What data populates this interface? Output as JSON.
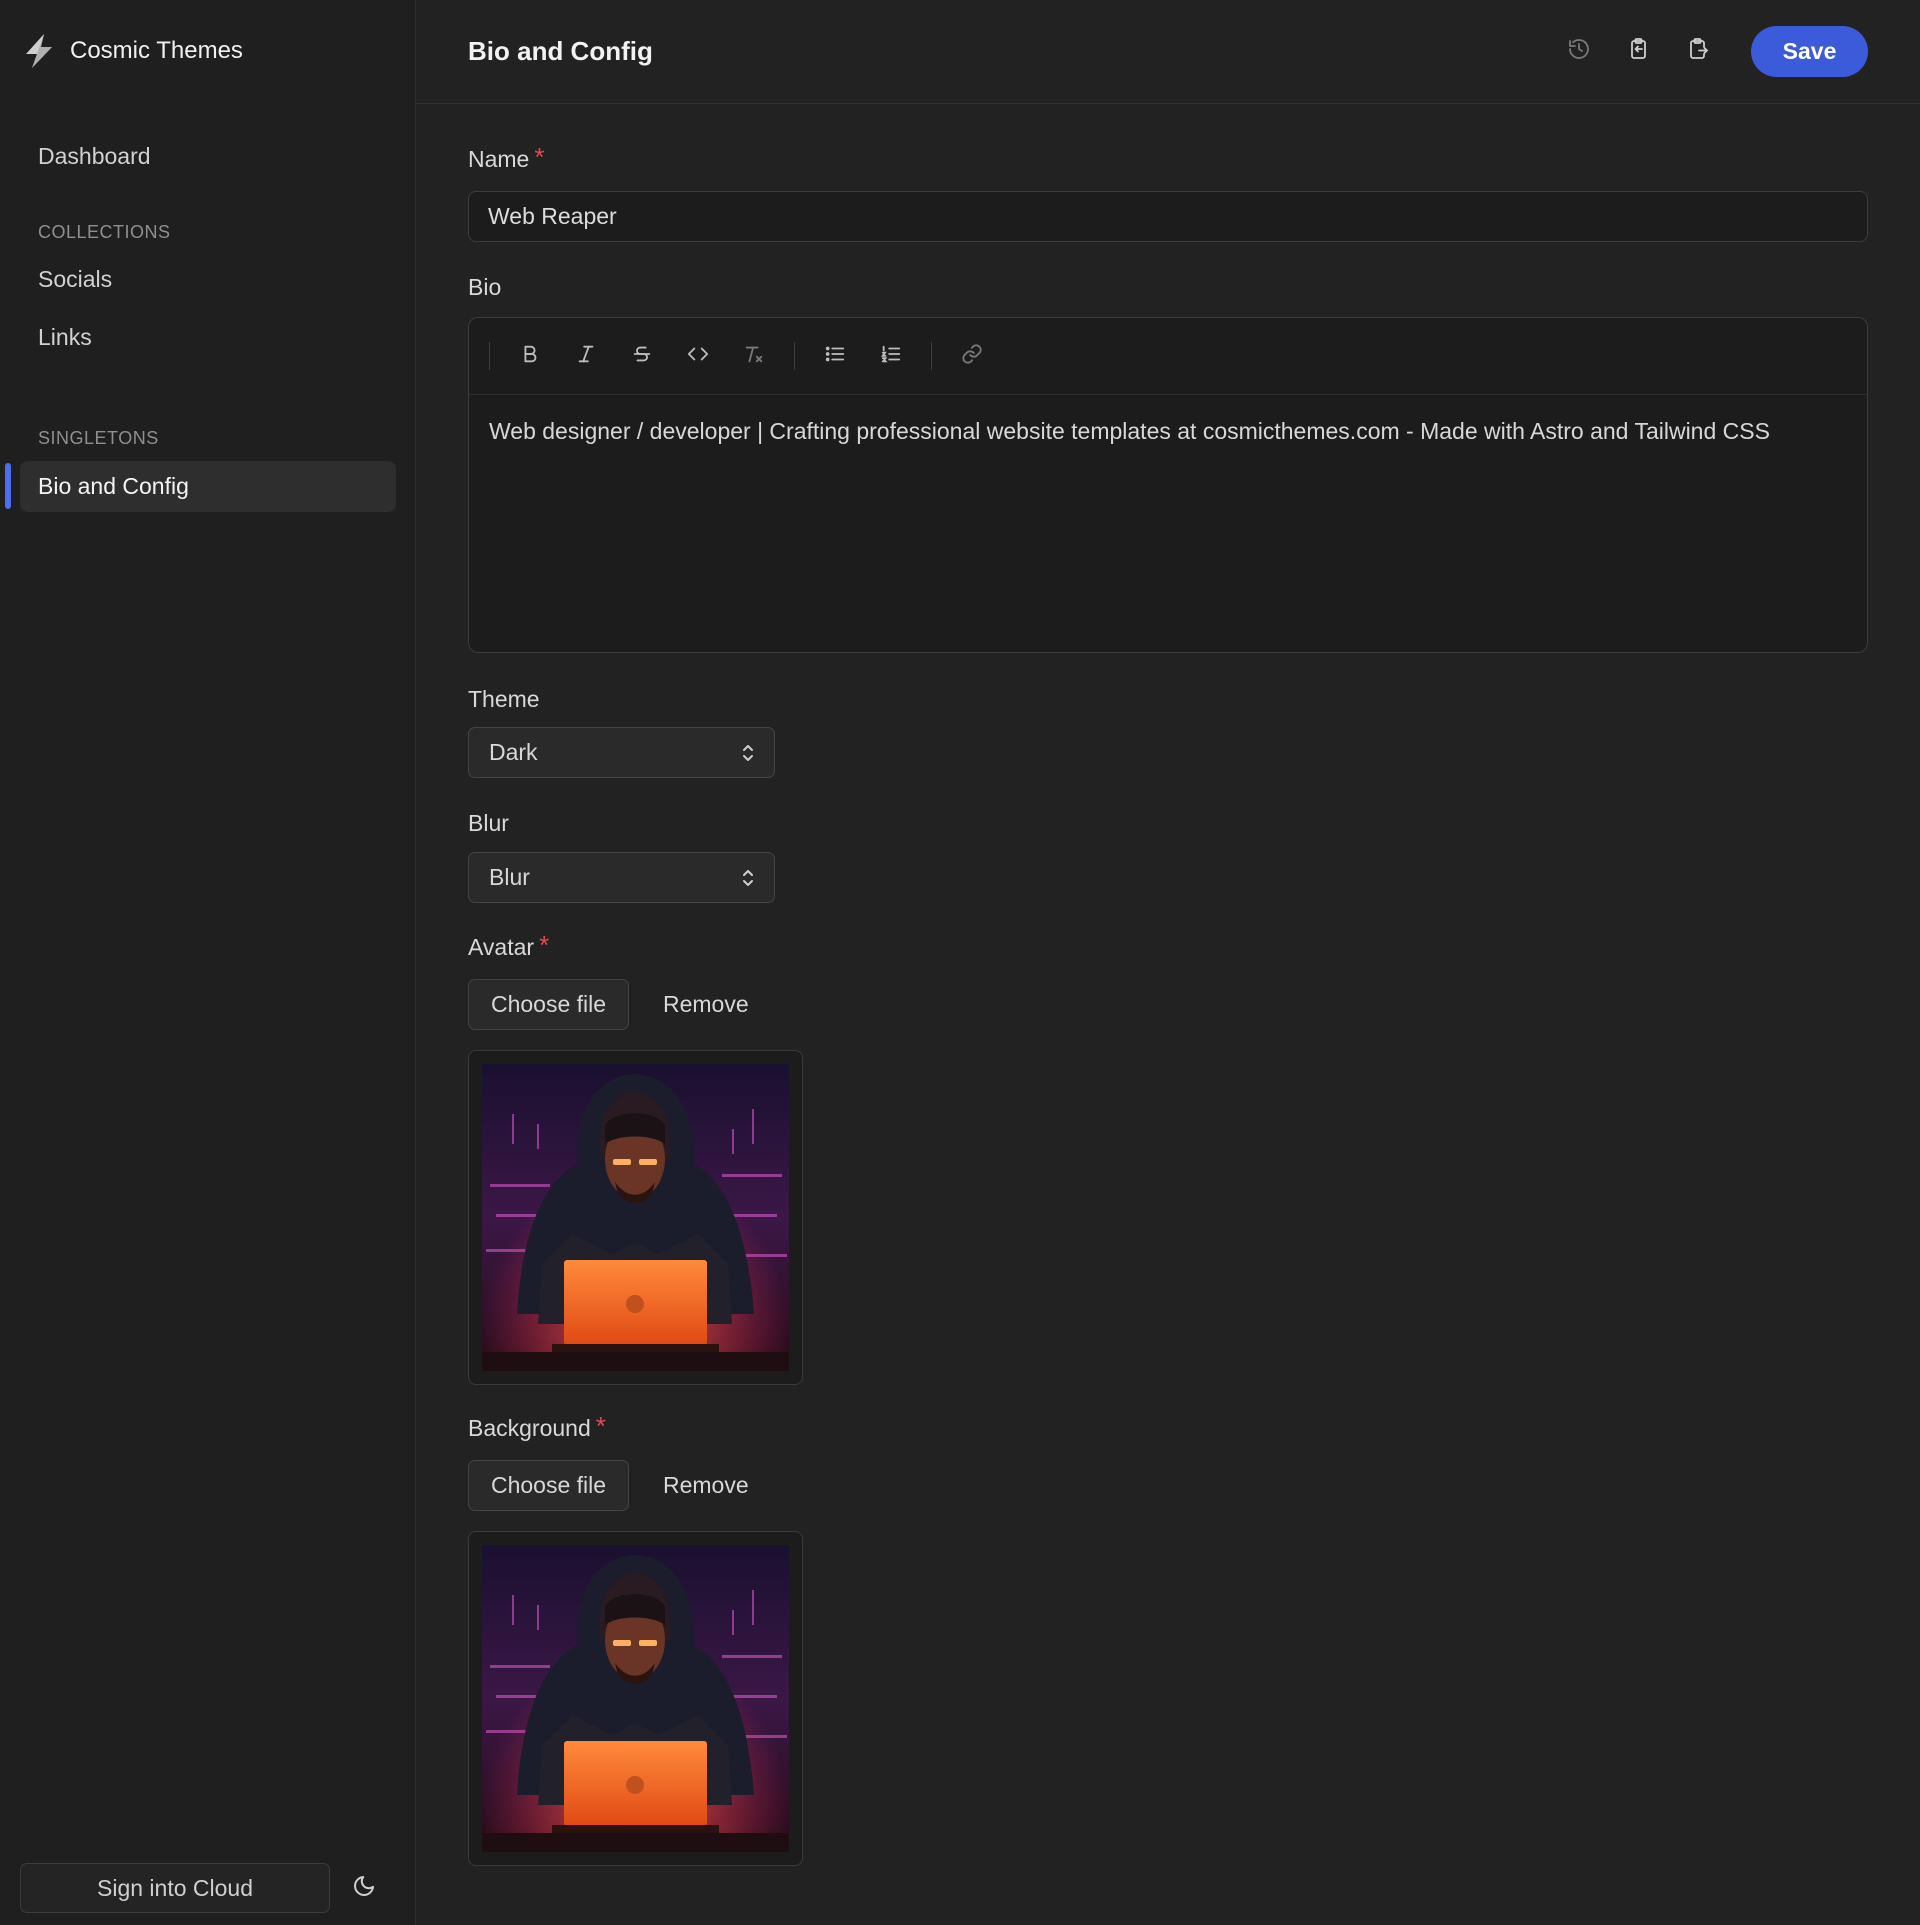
{
  "app": {
    "brand_name": "Cosmic Themes"
  },
  "sidebar": {
    "dashboard": "Dashboard",
    "collections_label": "COLLECTIONS",
    "collections": [
      {
        "label": "Socials"
      },
      {
        "label": "Links"
      }
    ],
    "singletons_label": "SINGLETONS",
    "singletons": [
      {
        "label": "Bio and Config",
        "active": true
      }
    ],
    "footer": {
      "sign_in_label": "Sign into Cloud"
    }
  },
  "header": {
    "title": "Bio and Config",
    "save_label": "Save"
  },
  "form": {
    "name": {
      "label": "Name",
      "required": true,
      "value": "Web Reaper"
    },
    "bio": {
      "label": "Bio",
      "content": "Web designer / developer | Crafting professional website templates at cosmicthemes.com - Made with Astro and Tailwind CSS"
    },
    "theme": {
      "label": "Theme",
      "value": "Dark"
    },
    "blur": {
      "label": "Blur",
      "value": "Blur"
    },
    "avatar": {
      "label": "Avatar",
      "required": true,
      "choose_label": "Choose file",
      "remove_label": "Remove"
    },
    "background": {
      "label": "Background",
      "required": true,
      "choose_label": "Choose file",
      "remove_label": "Remove"
    }
  },
  "colors": {
    "accent": "#3b5bdb",
    "active_indicator": "#4d6df0",
    "required": "#e5484d",
    "background": "#222222",
    "sidebar": "#1f1f1f"
  },
  "icons": {
    "brand": "lightning-logo-icon",
    "history": "history-icon",
    "copy": "clipboard-copy-icon",
    "paste": "clipboard-paste-icon",
    "theme_toggle": "moon-icon",
    "toolbar": [
      "bold-icon",
      "italic-icon",
      "strikethrough-icon",
      "code-icon",
      "clear-format-icon",
      "bullet-list-icon",
      "ordered-list-icon",
      "link-icon"
    ]
  }
}
